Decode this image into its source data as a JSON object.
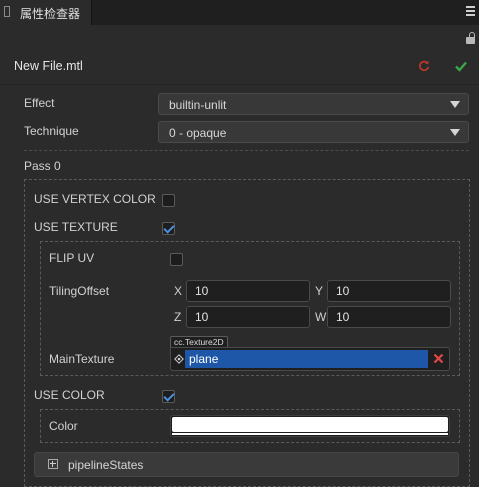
{
  "panel": {
    "tab_title": "属性检查器",
    "menu_icon": "menu-icon",
    "lock_icon": "lock-icon"
  },
  "file": {
    "name": "New File.mtl",
    "revert_icon": "revert-icon",
    "apply_icon": "check-icon"
  },
  "effect": {
    "label": "Effect",
    "value": "builtin-unlit"
  },
  "technique": {
    "label": "Technique",
    "value": "0 - opaque"
  },
  "pass": {
    "label": "Pass 0",
    "use_vertex_color": {
      "label": "USE VERTEX COLOR",
      "checked": false
    },
    "use_texture": {
      "label": "USE TEXTURE",
      "checked": true
    },
    "flip_uv": {
      "label": "FLIP UV",
      "checked": false
    },
    "tiling_offset": {
      "label": "TilingOffset",
      "x_label": "X",
      "x": "10",
      "y_label": "Y",
      "y": "10",
      "z_label": "Z",
      "z": "10",
      "w_label": "W",
      "w": "10"
    },
    "main_texture": {
      "label": "MainTexture",
      "type_tag": "cc.Texture2D",
      "value": "plane"
    },
    "use_color": {
      "label": "USE COLOR",
      "checked": true
    },
    "color": {
      "label": "Color",
      "value": "#ffffff"
    },
    "pipeline_states": {
      "label": "pipelineStates"
    }
  },
  "colors": {
    "accent": "#1e57a8",
    "check": "#4f8fe0",
    "revert": "#c0392b",
    "apply": "#3aa84a",
    "clear": "#e04848"
  }
}
